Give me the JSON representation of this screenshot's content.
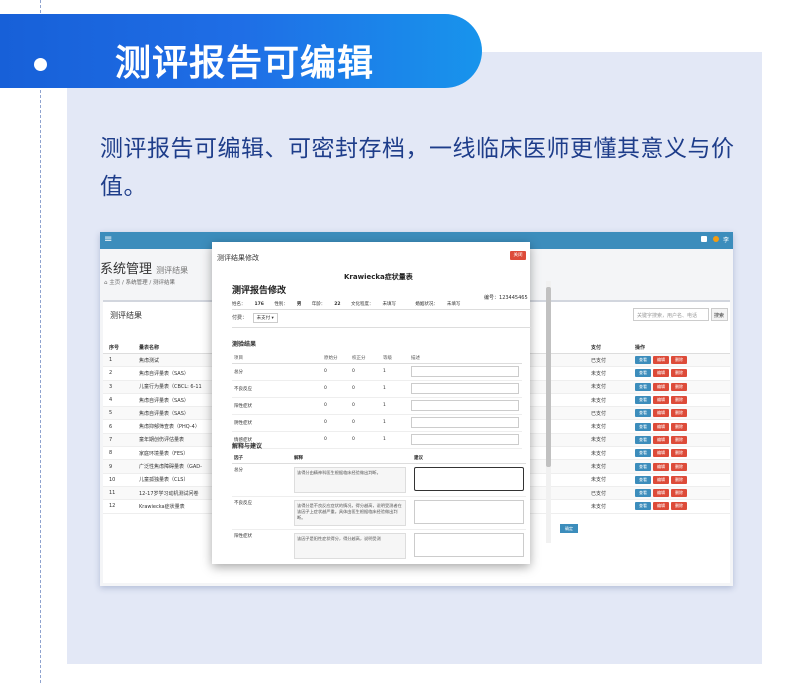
{
  "banner": {
    "title": "测评报告可编辑"
  },
  "intro": {
    "text": "测评报告可编辑、可密封存档，一线临床医师更懂其意义与价值。"
  },
  "app": {
    "menu_icon": "≡",
    "user_short": "李",
    "page_title": "系统管理",
    "page_subtitle": "测评结果",
    "breadcrumb": [
      "主页",
      "系统管理",
      "测评结果"
    ],
    "panel_title": "测评结果",
    "search_placeholder": "关键字搜索，用户名、电话",
    "search_button": "搜索",
    "columns": [
      "序号",
      "量表名称",
      "",
      "支付",
      "操作"
    ],
    "rows": [
      {
        "no": "1",
        "name": "焦虑测试",
        "pay": "已支付"
      },
      {
        "no": "2",
        "name": "焦虑自评量表（SAS）",
        "pay": "未支付"
      },
      {
        "no": "3",
        "name": "儿童行为量表（CBCL: 6-11",
        "pay": "未支付"
      },
      {
        "no": "4",
        "name": "焦虑自评量表（SAS）",
        "pay": "未支付"
      },
      {
        "no": "5",
        "name": "焦虑自评量表（SAS）",
        "pay": "已支付"
      },
      {
        "no": "6",
        "name": "焦虑抑郁筛查表（PHQ-4）",
        "pay": "未支付"
      },
      {
        "no": "7",
        "name": "童年期创伤评估量表",
        "pay": "未支付"
      },
      {
        "no": "8",
        "name": "家庭环境量表（FES）",
        "pay": "未支付"
      },
      {
        "no": "9",
        "name": "广泛性焦虑障碍量表（GAD-",
        "pay": "未支付"
      },
      {
        "no": "10",
        "name": "儿童孤独量表（CLS）",
        "pay": "未支付"
      },
      {
        "no": "11",
        "name": "12-17岁学习动机测试问卷",
        "pay": "已支付"
      },
      {
        "no": "12",
        "name": "Krawiecka症状量表",
        "pay": "未支付"
      }
    ],
    "btn_view": "查看",
    "btn_edit": "编辑",
    "btn_delete": "删除",
    "confirm_button": "确定"
  },
  "modal": {
    "title": "测评结果修改",
    "close_label": "关闭",
    "scale_name": "Krawiecka症状量表",
    "report_title": "测评报告修改",
    "report_no_label": "编号：",
    "report_no": "123445465",
    "info": {
      "name_label": "姓名：",
      "name": "176",
      "gender_label": "性别：",
      "gender": "男",
      "age_label": "年龄：",
      "age": "22",
      "edu_label": "文化程度：",
      "edu": "未填写",
      "marital_label": "婚姻状况：",
      "marital": "未填写"
    },
    "pay_label": "付费：",
    "pay_value": "未支付 ▾",
    "result_heading": "测验结果",
    "result_columns": [
      "项目",
      "原始分",
      "校正分",
      "等级",
      "描述"
    ],
    "results": [
      {
        "item": "总分",
        "raw": "0",
        "adj": "0",
        "grade": "1"
      },
      {
        "item": "不良反应",
        "raw": "0",
        "adj": "0",
        "grade": "1"
      },
      {
        "item": "阳性症状",
        "raw": "0",
        "adj": "0",
        "grade": "1"
      },
      {
        "item": "阴性症状",
        "raw": "0",
        "adj": "0",
        "grade": "1"
      },
      {
        "item": "情感症状",
        "raw": "0",
        "adj": "0",
        "grade": "1"
      }
    ],
    "explain_heading": "解释与建议",
    "explain_columns": [
      "因子",
      "解释",
      "建议"
    ],
    "explanations": [
      {
        "factor": "总分",
        "text": "该得分由精神科医生根据临床经验做出判断。"
      },
      {
        "factor": "不良反应",
        "text": "该得分是不良反应症状的情况，得分越高，说明受测者在该因子上症状越严重。具体由医生根据临床经验做出判断。"
      },
      {
        "factor": "阳性症状",
        "text": "该因子是阳性症状得分，得分越高，说明受测"
      }
    ]
  }
}
